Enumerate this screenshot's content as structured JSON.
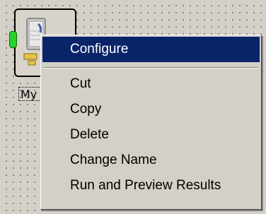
{
  "node": {
    "label": "My",
    "icon": "database-table-icon"
  },
  "context_menu": {
    "items": [
      {
        "label": "Configure",
        "selected": true
      },
      {
        "label": "Cut"
      },
      {
        "label": "Copy"
      },
      {
        "label": "Delete"
      },
      {
        "label": "Change Name"
      },
      {
        "label": "Run and Preview Results"
      }
    ]
  },
  "colors": {
    "selection": "#0a246a",
    "menu_background": "#d4d0c8",
    "port": "#2bd12b"
  }
}
